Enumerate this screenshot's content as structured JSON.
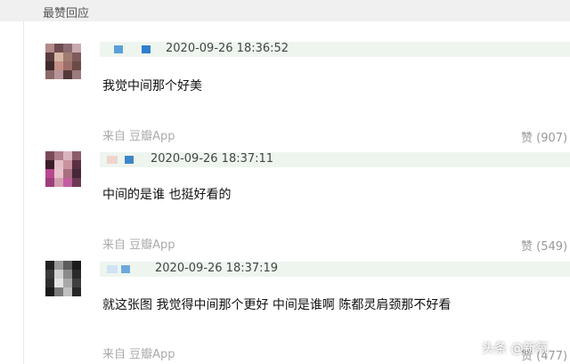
{
  "section": {
    "title": "最赞回应"
  },
  "comments": [
    {
      "timestamp": "2020-09-26 18:36:52",
      "text": "我觉中间那个好美",
      "source": "来自 豆瓣App",
      "likes": "赞 (907)"
    },
    {
      "timestamp": "2020-09-26 18:37:11",
      "text": "中间的是谁 也挺好看的",
      "source": "来自 豆瓣App",
      "likes": "赞 (549)"
    },
    {
      "timestamp": "2020-09-26 18:37:19",
      "text": "就这张图 我觉得中间那个更好 中间是谁啊 陈都灵肩颈那不好看",
      "source": "来自 豆瓣App",
      "likes": "赞 (477)"
    }
  ],
  "watermark": "头条 @新氧",
  "colors": {
    "meta_bar": "#eef5ef",
    "header_bg": "#f0f0f0",
    "source_text": "#aaaaaa"
  }
}
